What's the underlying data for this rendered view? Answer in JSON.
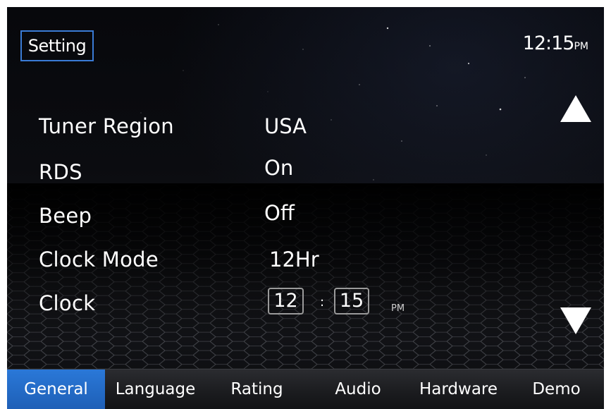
{
  "header": {
    "title": "Setting",
    "time": "12:15",
    "ampm": "PM"
  },
  "settings": [
    {
      "label": "Tuner Region",
      "value": "USA"
    },
    {
      "label": "RDS",
      "value": "On"
    },
    {
      "label": "Beep",
      "value": "Off"
    },
    {
      "label": "Clock Mode",
      "value": "12Hr"
    }
  ],
  "clock": {
    "label": "Clock",
    "hour": "12",
    "separator": ":",
    "minute": "15",
    "ampm": "PM"
  },
  "navigation": {
    "up_icon": "triangle-up-icon",
    "down_icon": "triangle-down-icon"
  },
  "tabs": [
    {
      "label": "General",
      "active": true
    },
    {
      "label": "Language",
      "active": false
    },
    {
      "label": "Rating",
      "active": false
    },
    {
      "label": "Audio",
      "active": false
    },
    {
      "label": "Hardware",
      "active": false
    },
    {
      "label": "Demo",
      "active": false
    }
  ],
  "colors": {
    "accent": "#2a78d8",
    "background": "#0b0c10",
    "text": "#ffffff"
  }
}
